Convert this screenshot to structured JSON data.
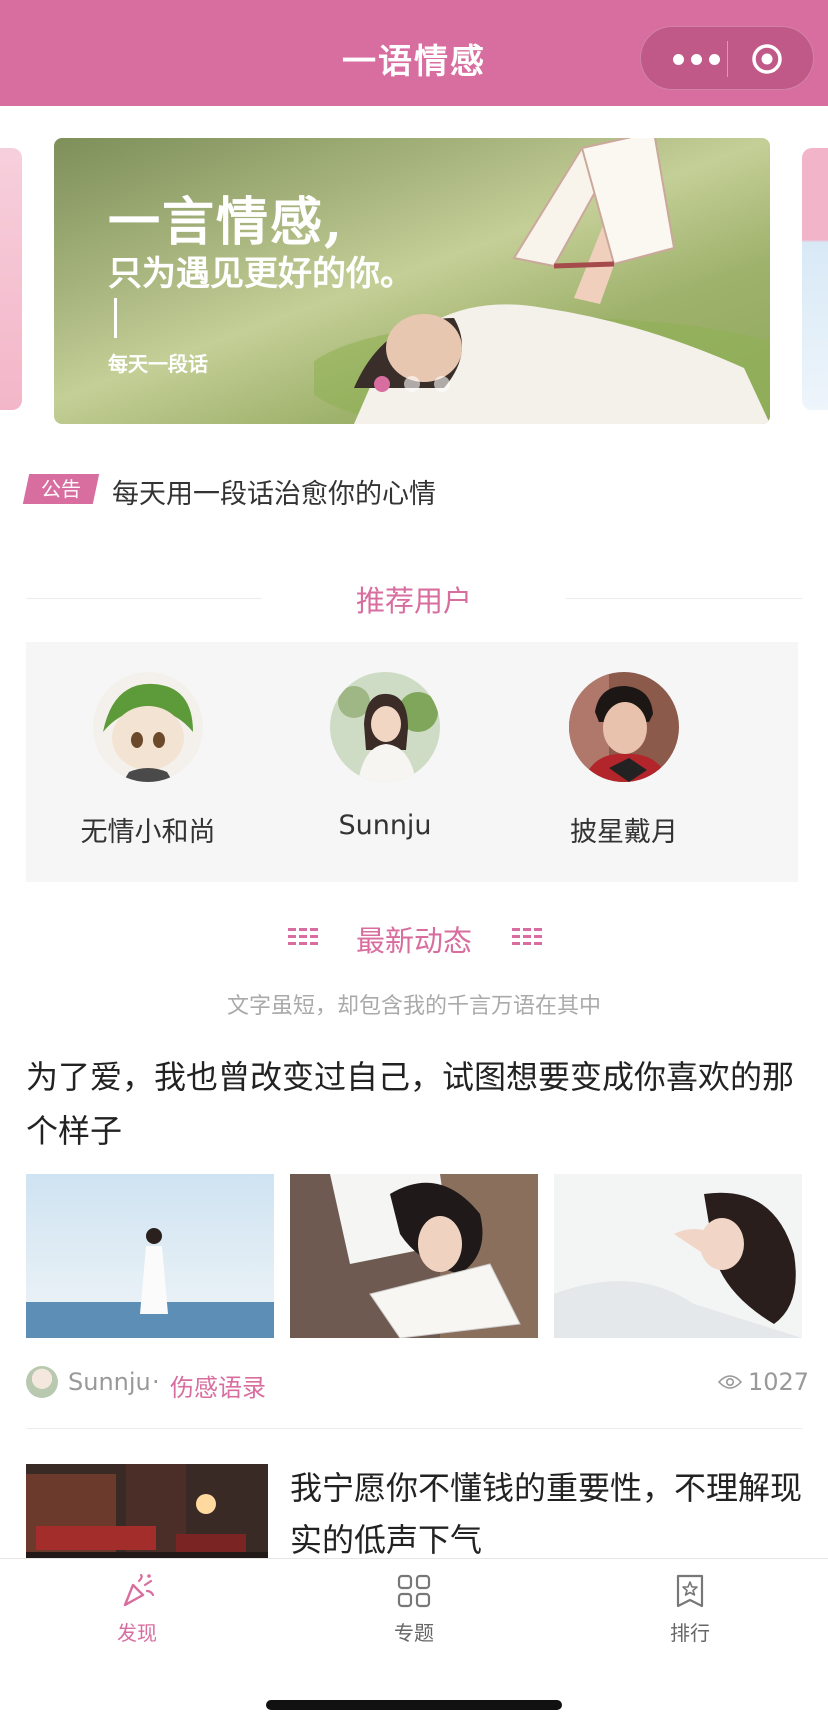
{
  "header": {
    "title": "一语情感",
    "more_icon": "more-dots-icon",
    "close_icon": "target-circle-icon"
  },
  "banner": {
    "line1": "一言情感,",
    "line2": "只为遇见更好的你。",
    "line3": "每天一段话",
    "indicator_count": 3,
    "active_index": 0
  },
  "notice": {
    "tag": "公告",
    "text": "每天用一段话治愈你的心情"
  },
  "recommended": {
    "title": "推荐用户",
    "users": [
      {
        "name": "无情小和尚"
      },
      {
        "name": "Sunnju"
      },
      {
        "name": "披星戴月"
      }
    ]
  },
  "latest": {
    "title": "最新动态",
    "subtitle": "文字虽短，却包含我的千言万语在其中"
  },
  "posts": [
    {
      "title": "为了爱，我也曾改变过自己，试图想要变成你喜欢的那个样子",
      "author": "Sunnju",
      "separator": "·",
      "category": "伤感语录",
      "views": "1027"
    },
    {
      "title": "我宁愿你不懂钱的重要性，不理解现实的低声下气"
    }
  ],
  "tabbar": {
    "items": [
      {
        "label": "发现",
        "icon": "party-popper-icon",
        "active": true
      },
      {
        "label": "专题",
        "icon": "grid-icon",
        "active": false
      },
      {
        "label": "排行",
        "icon": "bookmark-star-icon",
        "active": false
      }
    ]
  },
  "colors": {
    "accent": "#d86e9f",
    "muted": "#999999",
    "panel": "#f6f6f6"
  }
}
